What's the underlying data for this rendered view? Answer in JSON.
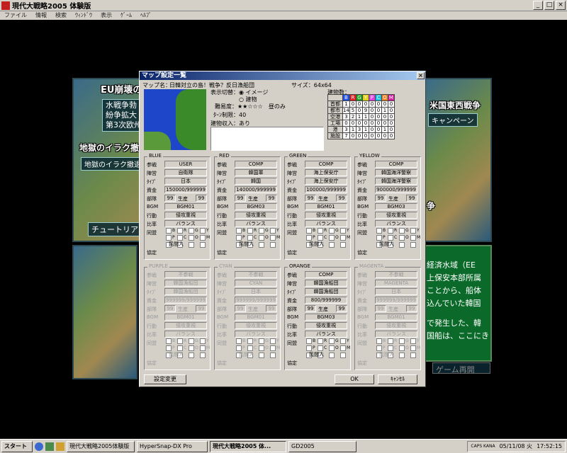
{
  "window": {
    "title": "現代大戦略2005 体験版",
    "min": "_",
    "max": "□",
    "close": "×"
  },
  "menu": [
    "ファイル",
    "情報",
    "検索",
    "ｳｨﾝﾄﾞｳ",
    "表示",
    "ｹﾞｰﾑ",
    "ﾍﾙﾌﾟ"
  ],
  "background": {
    "eu_title": "EU崩壊の",
    "eu_lines": [
      "水戦争勃",
      "紛争拡大",
      "第3次欧州"
    ],
    "iraq_title": "地獄のイラク撤退",
    "iraq_sub": "地獄のイラク撤退",
    "tutorial": "チュートリアル",
    "right_title": "米国東西戦争",
    "right_sub": "キャンペーン",
    "right_war": "争",
    "green_lines": [
      "経済水域（EE",
      "上保安本部所属",
      "ことから、船体",
      "込んでいた韓国"
    ],
    "green_lines2": [
      "で発生した、韓",
      "国船は、ここにき"
    ],
    "resume": "ゲーム再開"
  },
  "dialog": {
    "title": "マップ設定一覧",
    "close": "×",
    "map_label": "マップ名：",
    "map_name": "日韓対立の島！戦争？反日漁船団",
    "size": "サイズ：64x64",
    "display_switch": "表示切替：",
    "opt_image": "イメージ",
    "opt_building": "建物",
    "difficulty": "難易度：★★☆☆☆　昼のみ",
    "turn_limit": "ﾀｰﾝ制限：40",
    "income": "建物収入：あり",
    "building_count": "建物数：",
    "tbl_headers": [
      "B",
      "R",
      "G",
      "Y",
      "P",
      "C",
      "O",
      "M"
    ],
    "tbl_colors": [
      "#2050e0",
      "#e02020",
      "#20a020",
      "#e0d020",
      "#e040e0",
      "#20c0e0",
      "#f08020",
      "#d020a0"
    ],
    "tbl_rows": [
      {
        "label": "首都",
        "vals": [
          "1",
          "0",
          "0",
          "0",
          "0",
          "0",
          "0",
          "0"
        ]
      },
      {
        "label": "都市",
        "vals": [
          "14",
          "5",
          "0",
          "9",
          "0",
          "0",
          "1",
          "0"
        ]
      },
      {
        "label": "空港",
        "vals": [
          "3",
          "2",
          "1",
          "1",
          "0",
          "0",
          "0",
          "0"
        ]
      },
      {
        "label": "工場",
        "vals": [
          "0",
          "0",
          "0",
          "0",
          "0",
          "0",
          "0",
          "0"
        ]
      },
      {
        "label": "港",
        "vals": [
          "3",
          "1",
          "3",
          "1",
          "0",
          "0",
          "1",
          "0"
        ]
      },
      {
        "label": "施設",
        "vals": [
          "7",
          "0",
          "0",
          "0",
          "0",
          "0",
          "0",
          "0"
        ]
      }
    ],
    "row_labels": {
      "join": "参戦",
      "faction": "陣営",
      "type": "ﾀｲﾌﾟ",
      "funds": "資金",
      "units": "部隊",
      "produce": "生産",
      "bgm": "BGM",
      "action": "行動",
      "ratio": "比率",
      "ally": "同盟",
      "civilian": "民間人",
      "pact": "協定"
    },
    "change_button": "設定変更",
    "ok_button": "OK",
    "cancel_button": "ｷｬﾝｾﾙ",
    "teams": [
      {
        "name": "BLUE",
        "join": "USER",
        "faction": "自衛隊",
        "type": "日本",
        "funds": "150000/999999",
        "units": "99",
        "produce": "99",
        "bgm": "BGM01",
        "action": "侵攻重視",
        "ratio": "バランス",
        "disabled": false
      },
      {
        "name": "RED",
        "join": "COMP",
        "faction": "韓国軍",
        "type": "韓国",
        "funds": "140000/999999",
        "units": "99",
        "produce": "99",
        "bgm": "BGM03",
        "action": "侵攻重視",
        "ratio": "バランス",
        "disabled": false
      },
      {
        "name": "GREEN",
        "join": "COMP",
        "faction": "海上保安庁",
        "type": "海上保安庁",
        "funds": "100000/999999",
        "units": "99",
        "produce": "99",
        "bgm": "BGM01",
        "action": "侵攻重視",
        "ratio": "バランス",
        "disabled": false
      },
      {
        "name": "YELLOW",
        "join": "COMP",
        "faction": "韓国海洋警察",
        "type": "韓国海洋警察",
        "funds": "900000/999999",
        "units": "99",
        "produce": "99",
        "bgm": "BGM03",
        "action": "侵攻重視",
        "ratio": "バランス",
        "disabled": false
      },
      {
        "name": "PURPLE",
        "join": "不参戦",
        "faction": "韓国漁船団",
        "type": "韓国漁船団",
        "funds": "999999/999999",
        "units": "99",
        "produce": "99",
        "bgm": "BGM01",
        "action": "侵攻重視",
        "ratio": "バランス",
        "disabled": true
      },
      {
        "name": "CYAN",
        "join": "不参戦",
        "faction": "CYAN",
        "type": "日本",
        "funds": "999999/999999",
        "units": "99",
        "produce": "99",
        "bgm": "BGM01",
        "action": "侵攻重視",
        "ratio": "バランス",
        "disabled": true
      },
      {
        "name": "ORANGE",
        "join": "COMP",
        "faction": "韓国漁船団",
        "type": "韓国漁船団",
        "funds": "800/999999",
        "units": "99",
        "produce": "99",
        "bgm": "BGM03",
        "action": "侵攻重視",
        "ratio": "バランス",
        "disabled": false
      },
      {
        "name": "MAGENTA",
        "join": "不参戦",
        "faction": "MAGENTA",
        "type": "日本",
        "funds": "999999/999999",
        "units": "99",
        "produce": "99",
        "bgm": "BGM01",
        "action": "侵攻重視",
        "ratio": "バランス",
        "disabled": true
      }
    ],
    "ally_letters": [
      "B",
      "R",
      "G",
      "Y",
      "P",
      "C",
      "O",
      "M"
    ]
  },
  "taskbar": {
    "start": "スタート",
    "items": [
      "現代大戦略2005体験版",
      "HyperSnap-DX Pro",
      "現代大戦略2005 体...",
      "GD2005"
    ],
    "date": "05/11/08 火",
    "time": "17:52:15",
    "caps": "CAPS KANA"
  }
}
